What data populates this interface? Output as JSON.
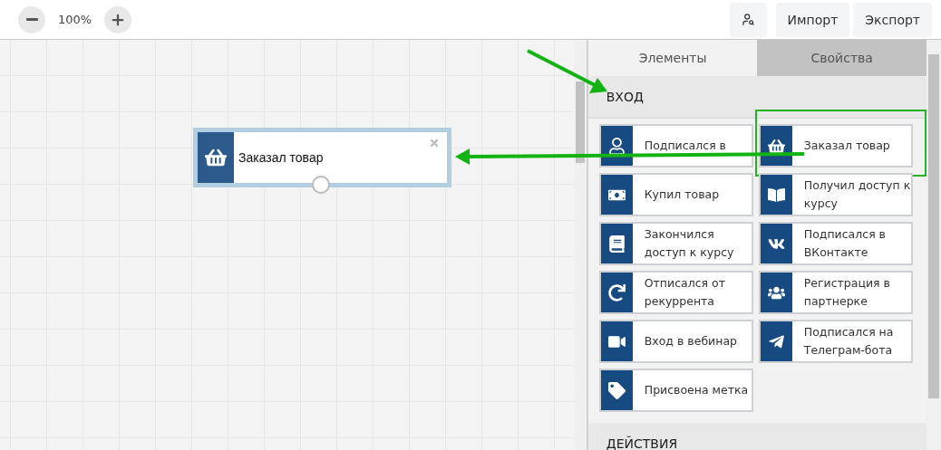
{
  "toolbar": {
    "zoom": "100%",
    "buttons": [
      "Импорт",
      "Экспорт"
    ]
  },
  "canvas": {
    "node": {
      "title": "Заказал товар"
    }
  },
  "panel": {
    "tabs": [
      {
        "label": "Элементы",
        "selected": true
      },
      {
        "label": "Свойства",
        "selected": false
      }
    ],
    "sections": [
      {
        "title": "ВХОД",
        "rows": [
          [
            {
              "label": "Подписался в",
              "highlighted": false
            },
            {
              "label": "Заказал товар",
              "highlighted": true
            }
          ],
          [
            {
              "label": "Купил товар",
              "highlighted": false
            },
            {
              "label": "Получил доступ к курсу",
              "highlighted": false
            }
          ],
          [
            {
              "label": "Закончился доступ к курсу",
              "highlighted": false
            },
            {
              "label": "Подписался в ВКонтакте",
              "highlighted": false
            }
          ],
          [
            {
              "label": "Отписался от рекуррента",
              "highlighted": false
            },
            {
              "label": "Регистрация в партнерке",
              "highlighted": false
            }
          ],
          [
            {
              "label": "Вход в вебинар",
              "highlighted": false
            },
            {
              "label": "Подписался на Телеграм-бота",
              "highlighted": false
            }
          ],
          [
            {
              "label": "Присвоена метка",
              "highlighted": false
            }
          ]
        ]
      },
      {
        "title": "ДЕЙСТВИЯ"
      }
    ]
  }
}
